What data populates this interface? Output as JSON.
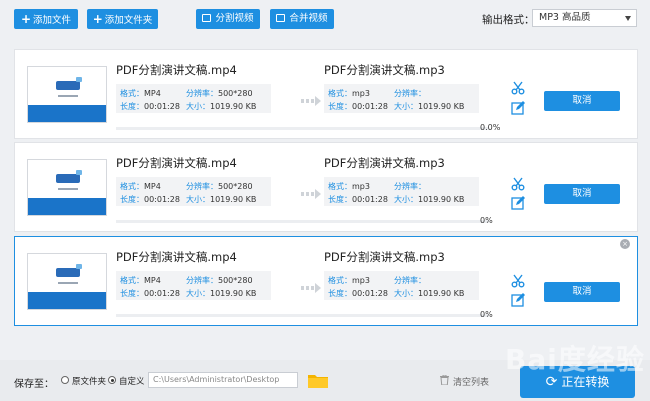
{
  "toolbar": {
    "add_file": "添加文件",
    "add_folder": "添加文件夹",
    "split_video": "分割视频",
    "merge_video": "合并视频",
    "output_format_label": "输出格式：",
    "output_format_value": "MP3  高品质"
  },
  "tasks": [
    {
      "source_name": "PDF分割演讲文稿.mp4",
      "target_name": "PDF分割演讲文稿.mp3",
      "src_format_label": "格式：",
      "src_format": "MP4",
      "src_res_label": "分辨率：",
      "src_res": "500*280",
      "src_len_label": "长度：",
      "src_len": "00:01:28",
      "src_size_label": "大小：",
      "src_size": "1019.90 KB",
      "dst_format_label": "格式：",
      "dst_format": "mp3",
      "dst_res_label": "分辨率：",
      "dst_res": "",
      "dst_len_label": "长度：",
      "dst_len": "00:01:28",
      "dst_size_label": "大小：",
      "dst_size": "1019.90 KB",
      "progress": "0.0%",
      "cancel": "取消"
    },
    {
      "source_name": "PDF分割演讲文稿.mp4",
      "target_name": "PDF分割演讲文稿.mp3",
      "src_format_label": "格式：",
      "src_format": "MP4",
      "src_res_label": "分辨率：",
      "src_res": "500*280",
      "src_len_label": "长度：",
      "src_len": "00:01:28",
      "src_size_label": "大小：",
      "src_size": "1019.90 KB",
      "dst_format_label": "格式：",
      "dst_format": "mp3",
      "dst_res_label": "分辨率：",
      "dst_res": "",
      "dst_len_label": "长度：",
      "dst_len": "00:01:28",
      "dst_size_label": "大小：",
      "dst_size": "1019.90 KB",
      "progress": "0%",
      "cancel": "取消"
    },
    {
      "source_name": "PDF分割演讲文稿.mp4",
      "target_name": "PDF分割演讲文稿.mp3",
      "src_format_label": "格式：",
      "src_format": "MP4",
      "src_res_label": "分辨率：",
      "src_res": "500*280",
      "src_len_label": "长度：",
      "src_len": "00:01:28",
      "src_size_label": "大小：",
      "src_size": "1019.90 KB",
      "dst_format_label": "格式：",
      "dst_format": "mp3",
      "dst_res_label": "分辨率：",
      "dst_res": "",
      "dst_len_label": "长度：",
      "dst_len": "00:01:28",
      "dst_size_label": "大小：",
      "dst_size": "1019.90 KB",
      "progress": "0%",
      "cancel": "取消"
    }
  ],
  "bottom": {
    "save_to_label": "保存至：",
    "option_source_folder": "原文件夹",
    "option_custom": "自定义",
    "path": "C:\\Users\\Administrator\\Desktop",
    "clear_list": "清空列表",
    "convert": "正在转换"
  },
  "watermark": "Bai度经验",
  "colors": {
    "accent": "#1e8fe1",
    "selected_border": "#1e8fe1"
  },
  "icons": [
    "plus-icon",
    "split-icon",
    "merge-icon",
    "arrow-right-icon",
    "scissors-icon",
    "edit-icon",
    "close-icon",
    "folder-icon",
    "trash-icon",
    "convert-icon"
  ]
}
